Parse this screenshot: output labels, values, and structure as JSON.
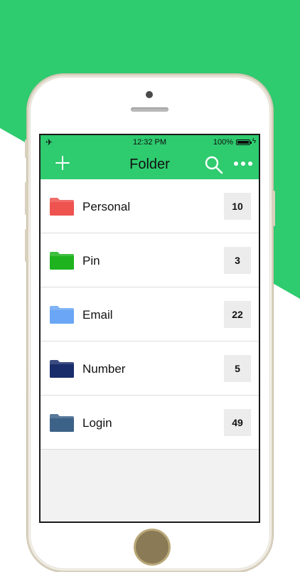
{
  "colors": {
    "brand_green": "#2ecb6f",
    "personal_folder": "#ef5350",
    "pin_folder": "#1eb31e",
    "email_folder": "#6aa6f5",
    "number_folder": "#1a2d6b",
    "login_folder": "#3c6288"
  },
  "status_bar": {
    "airplane_icon": "airplane-icon",
    "time": "12:32 PM",
    "battery_percent": "100%",
    "battery_level": 1.0
  },
  "nav": {
    "title": "Folder",
    "add_icon": "plus-icon",
    "search_icon": "search-icon",
    "more_icon": "more-dots-icon"
  },
  "folders": [
    {
      "name": "Personal",
      "count": "10",
      "color": "#ef5350"
    },
    {
      "name": "Pin",
      "count": "3",
      "color": "#1eb31e"
    },
    {
      "name": "Email",
      "count": "22",
      "color": "#6aa6f5"
    },
    {
      "name": "Number",
      "count": "5",
      "color": "#1a2d6b"
    },
    {
      "name": "Login",
      "count": "49",
      "color": "#3c6288"
    }
  ]
}
